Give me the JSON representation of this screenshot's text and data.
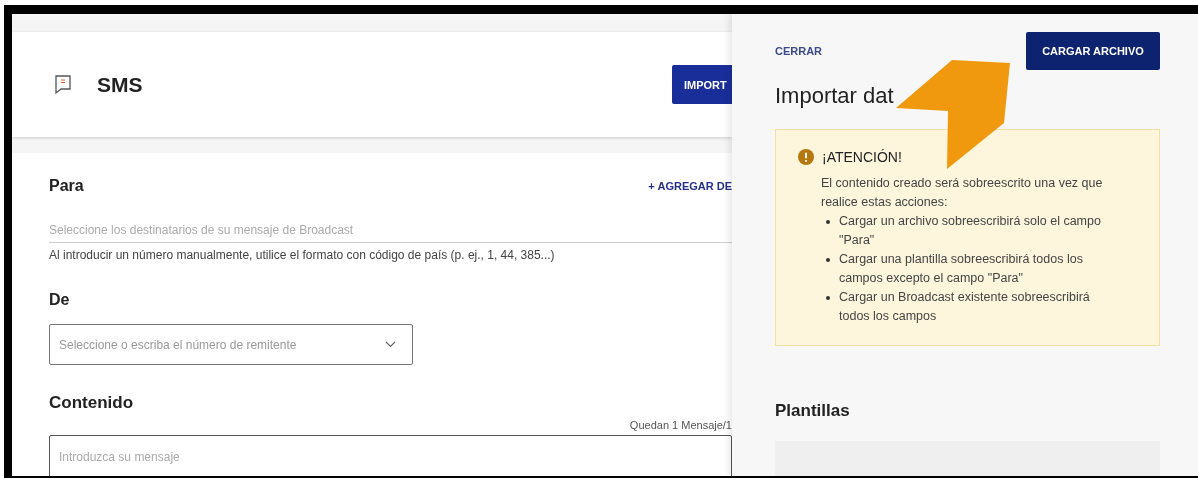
{
  "header": {
    "title": "SMS",
    "import_button": "IMPORT"
  },
  "form": {
    "to": {
      "label": "Para",
      "add_link": "+ AGREGAR DE",
      "placeholder": "Seleccione los destinatarios de su mensaje de Broadcast",
      "hint": "Al introducir un número manualmente, utilice el formato con código de país (p. ej., 1, 44, 385...)"
    },
    "from": {
      "label": "De",
      "placeholder": "Seleccione o escriba el número de remitente"
    },
    "content": {
      "label": "Contenido",
      "counter": "Quedan 1 Mensaje/1",
      "placeholder": "Introduzca su mensaje"
    }
  },
  "import_panel": {
    "close_link": "CERRAR",
    "upload_button": "CARGAR ARCHIVO",
    "title": "Importar dat",
    "alert": {
      "title": "¡ATENCIÓN!",
      "text": "El contenido creado será sobreescrito una vez que realice estas acciones:",
      "items": [
        "Cargar un archivo sobreescribirá solo el campo \"Para\"",
        "Cargar una plantilla sobreescribirá todos los campos excepto el campo \"Para\"",
        "Cargar un Broadcast existente sobreescribirá todos los campos"
      ]
    },
    "templates_title": "Plantillas"
  }
}
